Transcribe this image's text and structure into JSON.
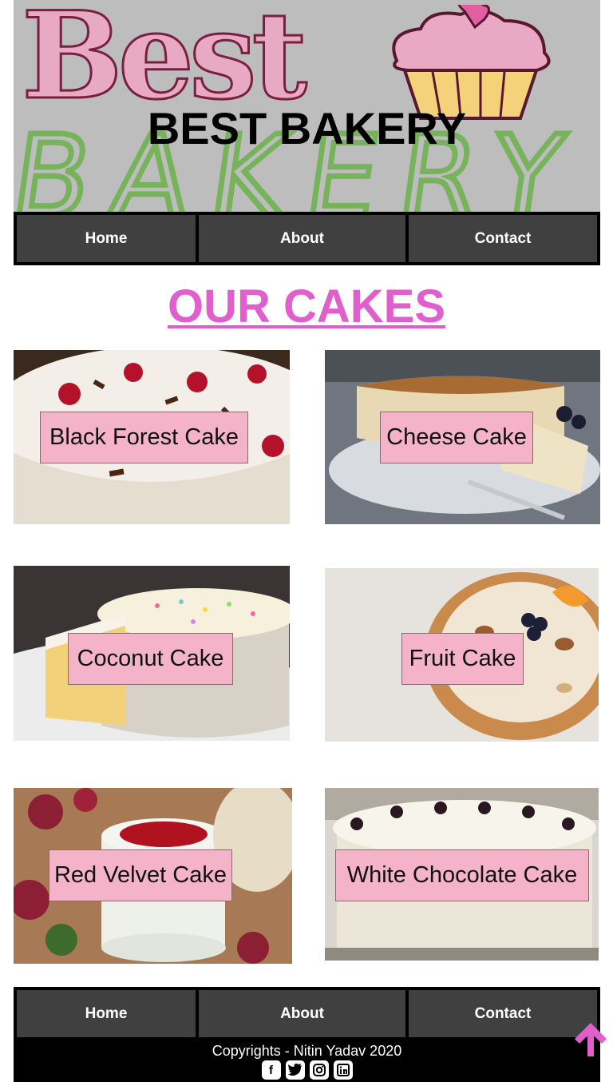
{
  "banner": {
    "logo_word_top": "Best",
    "logo_word_bottom": "BAKERY",
    "title": "BEST BAKERY"
  },
  "nav_top": {
    "home": "Home",
    "about": "About",
    "contact": "Contact"
  },
  "section_heading": "OUR CAKES",
  "cakes": [
    {
      "label": "Black Forest Cake"
    },
    {
      "label": "Cheese Cake"
    },
    {
      "label": "Coconut Cake"
    },
    {
      "label": "Fruit Cake"
    },
    {
      "label": "Red Velvet Cake"
    },
    {
      "label": "White Chocolate Cake"
    }
  ],
  "nav_bottom": {
    "home": "Home",
    "about": "About",
    "contact": "Contact"
  },
  "footer": {
    "copyright": "Copyrights - Nitin Yadav 2020",
    "social_icons": [
      "facebook-icon",
      "twitter-icon",
      "instagram-icon",
      "linkedin-icon"
    ]
  },
  "colors": {
    "heading": "#e05fcc",
    "label_bg": "#f4b3c9",
    "nav_bg": "#404040",
    "arrow": "#e05fcc"
  }
}
